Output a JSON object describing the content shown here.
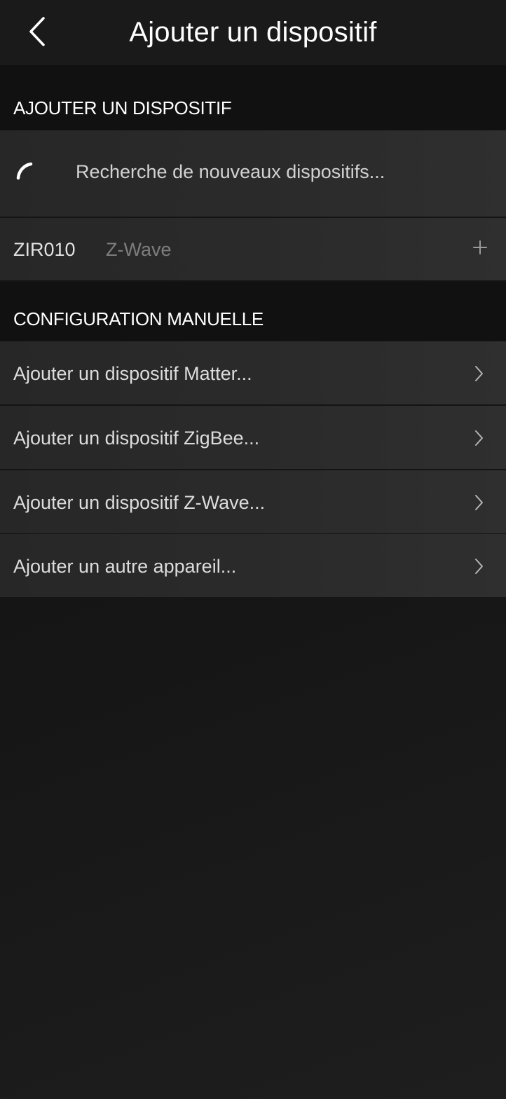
{
  "header": {
    "title": "Ajouter un dispositif"
  },
  "section_add": {
    "title": "AJOUTER UN DISPOSITIF"
  },
  "scan": {
    "status_text": "Recherche de nouveaux dispositifs..."
  },
  "discovered_device": {
    "name": "ZIR010",
    "protocol": "Z-Wave"
  },
  "section_manual": {
    "title": "CONFIGURATION MANUELLE"
  },
  "manual_items": [
    {
      "label": "Ajouter un dispositif Matter..."
    },
    {
      "label": "Ajouter un dispositif ZigBee..."
    },
    {
      "label": "Ajouter un dispositif Z-Wave..."
    },
    {
      "label": "Ajouter un autre appareil..."
    }
  ],
  "icons": {
    "back": "chevron-left-icon",
    "spinner": "loading-spinner-icon",
    "add": "plus-icon",
    "row_chevron": "chevron-right-icon"
  },
  "colors": {
    "background": "#151515",
    "header_bg": "#1a1a1a",
    "section_bg": "#111111",
    "row_bg": "#2a2a2a",
    "text_primary": "#ffffff",
    "text_secondary": "#7d7d7d"
  }
}
